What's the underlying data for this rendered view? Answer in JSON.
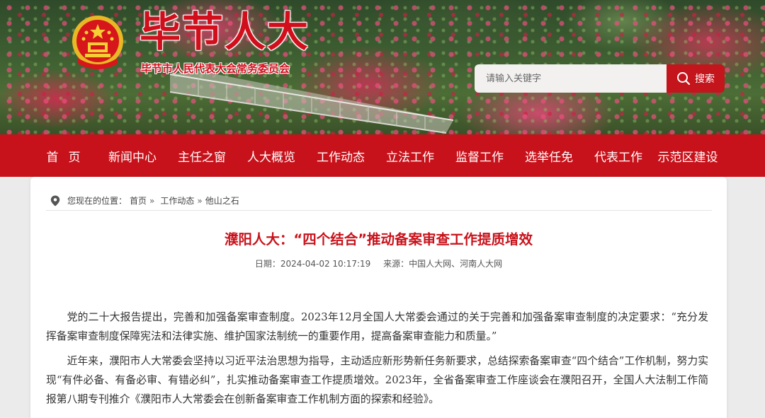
{
  "header": {
    "site_title": "毕节人大",
    "site_subtitle": "毕节市人民代表大会常务委员会",
    "emblem_icon": "national-emblem-icon",
    "search": {
      "placeholder": "请输入关键字",
      "button_label": "搜索",
      "icon": "search-icon"
    }
  },
  "nav": {
    "items": [
      {
        "label": "首页"
      },
      {
        "label": "新闻中心"
      },
      {
        "label": "主任之窗"
      },
      {
        "label": "人大概览"
      },
      {
        "label": "工作动态"
      },
      {
        "label": "立法工作"
      },
      {
        "label": "监督工作"
      },
      {
        "label": "选举任免"
      },
      {
        "label": "代表工作"
      },
      {
        "label": "示范区建设"
      }
    ]
  },
  "breadcrumb": {
    "prefix": "您现在的位置：",
    "items": [
      "首页",
      "工作动态",
      "他山之石"
    ],
    "separator": "»",
    "icon": "location-pin-icon"
  },
  "article": {
    "title": "濮阳人大：“四个结合”推动备案审查工作提质增效",
    "date": "日期：2024-04-02 10:17:19",
    "source": "来源：中国人大网、河南人大网",
    "paragraphs": [
      "党的二十大报告提出，完善和加强备案审查制度。2023年12月全国人大常委会通过的关于完善和加强备案审查制度的决定要求：“充分发挥备案审查制度保障宪法和法律实施、维护国家法制统一的重要作用，提高备案审查能力和质量。”",
      "近年来，濮阳市人大常委会坚持以习近平法治思想为指导，主动适应新形势新任务新要求，总结探索备案审查“四个结合”工作机制，努力实现“有件必备、有备必审、有错必纠”，扎实推动备案审查工作提质增效。2023年，全省备案审查工作座谈会在濮阳召开，全国人大法制工作简报第八期专刊推介《濮阳市人大常委会在创新备案审查工作机制方面的探索和经验》。"
    ]
  },
  "colors": {
    "brand_red": "#c8121b",
    "title_red": "#d10f1c"
  }
}
